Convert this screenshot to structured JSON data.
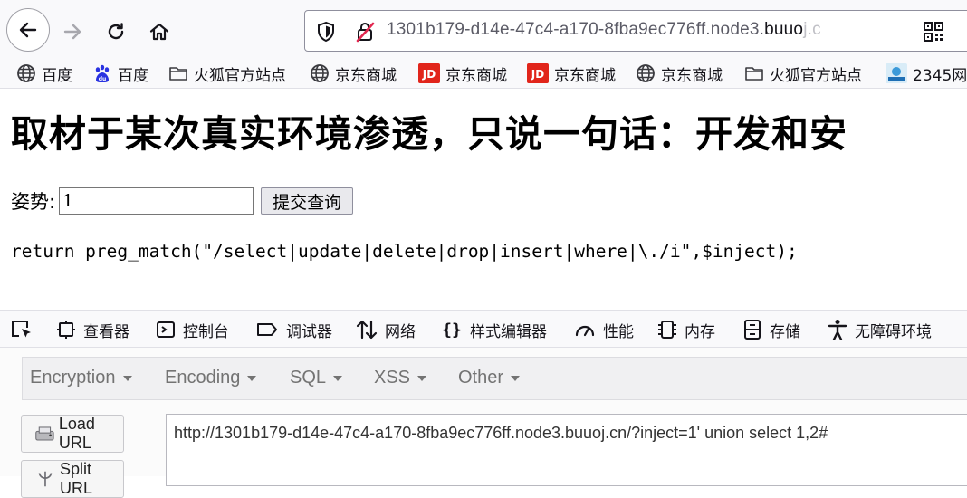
{
  "browser": {
    "url_prefix": "1301b179-d14e-47c4-a170-8fba9ec776ff.node3.",
    "url_host": "buuo",
    "url_fade": "j.c"
  },
  "bookmarks": [
    {
      "label": "百度",
      "icon": "globe-icon"
    },
    {
      "label": "百度",
      "icon": "baidu-paw-icon"
    },
    {
      "label": "火狐官方站点",
      "icon": "folder-icon"
    },
    {
      "label": "京东商城",
      "icon": "globe-icon"
    },
    {
      "label": "京东商城",
      "icon": "jd-logo-icon"
    },
    {
      "label": "京东商城",
      "icon": "jd-logo-icon"
    },
    {
      "label": "京东商城",
      "icon": "globe-icon"
    },
    {
      "label": "火狐官方站点",
      "icon": "folder-icon"
    },
    {
      "label": "2345网",
      "icon": "site-2345-icon"
    }
  ],
  "page": {
    "heading": "取材于某次真实环境渗透，只说一句话：开发和安",
    "form": {
      "label": "姿势:",
      "input_value": "1",
      "submit_label": "提交查询"
    },
    "code": "return preg_match(\"/select|update|delete|drop|insert|where|\\./i\",$inject);"
  },
  "devtools": {
    "tabs": [
      {
        "label": "查看器",
        "icon": "inspector-icon"
      },
      {
        "label": "控制台",
        "icon": "console-icon"
      },
      {
        "label": "调试器",
        "icon": "debugger-icon"
      },
      {
        "label": "网络",
        "icon": "network-icon"
      },
      {
        "label": "样式编辑器",
        "icon": "style-editor-icon"
      },
      {
        "label": "性能",
        "icon": "performance-icon"
      },
      {
        "label": "内存",
        "icon": "memory-icon"
      },
      {
        "label": "存储",
        "icon": "storage-icon"
      },
      {
        "label": "无障碍环境",
        "icon": "accessibility-icon"
      }
    ]
  },
  "hackbar": {
    "menus": [
      "Encryption",
      "Encoding",
      "SQL",
      "XSS",
      "Other"
    ],
    "load_url_label": "Load URL",
    "split_url_label": "Split URL",
    "url_value": "http://1301b179-d14e-47c4-a170-8fba9ec776ff.node3.buuoj.cn/?inject=1' union select 1,2#"
  },
  "colors": {
    "chrome_bg": "#f9f9fb",
    "jd_red": "#e1251b",
    "baidu_blue": "#2932e1"
  }
}
